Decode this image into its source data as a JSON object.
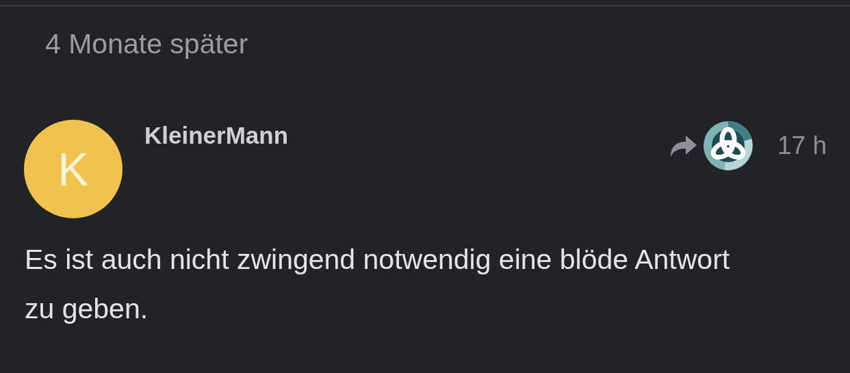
{
  "time_gap": "4 Monate später",
  "post": {
    "avatar_letter": "K",
    "username": "KleinerMann",
    "time": "17 h",
    "text": "Es ist auch nicht zwingend notwendig eine blöde Antwort zu geben."
  }
}
